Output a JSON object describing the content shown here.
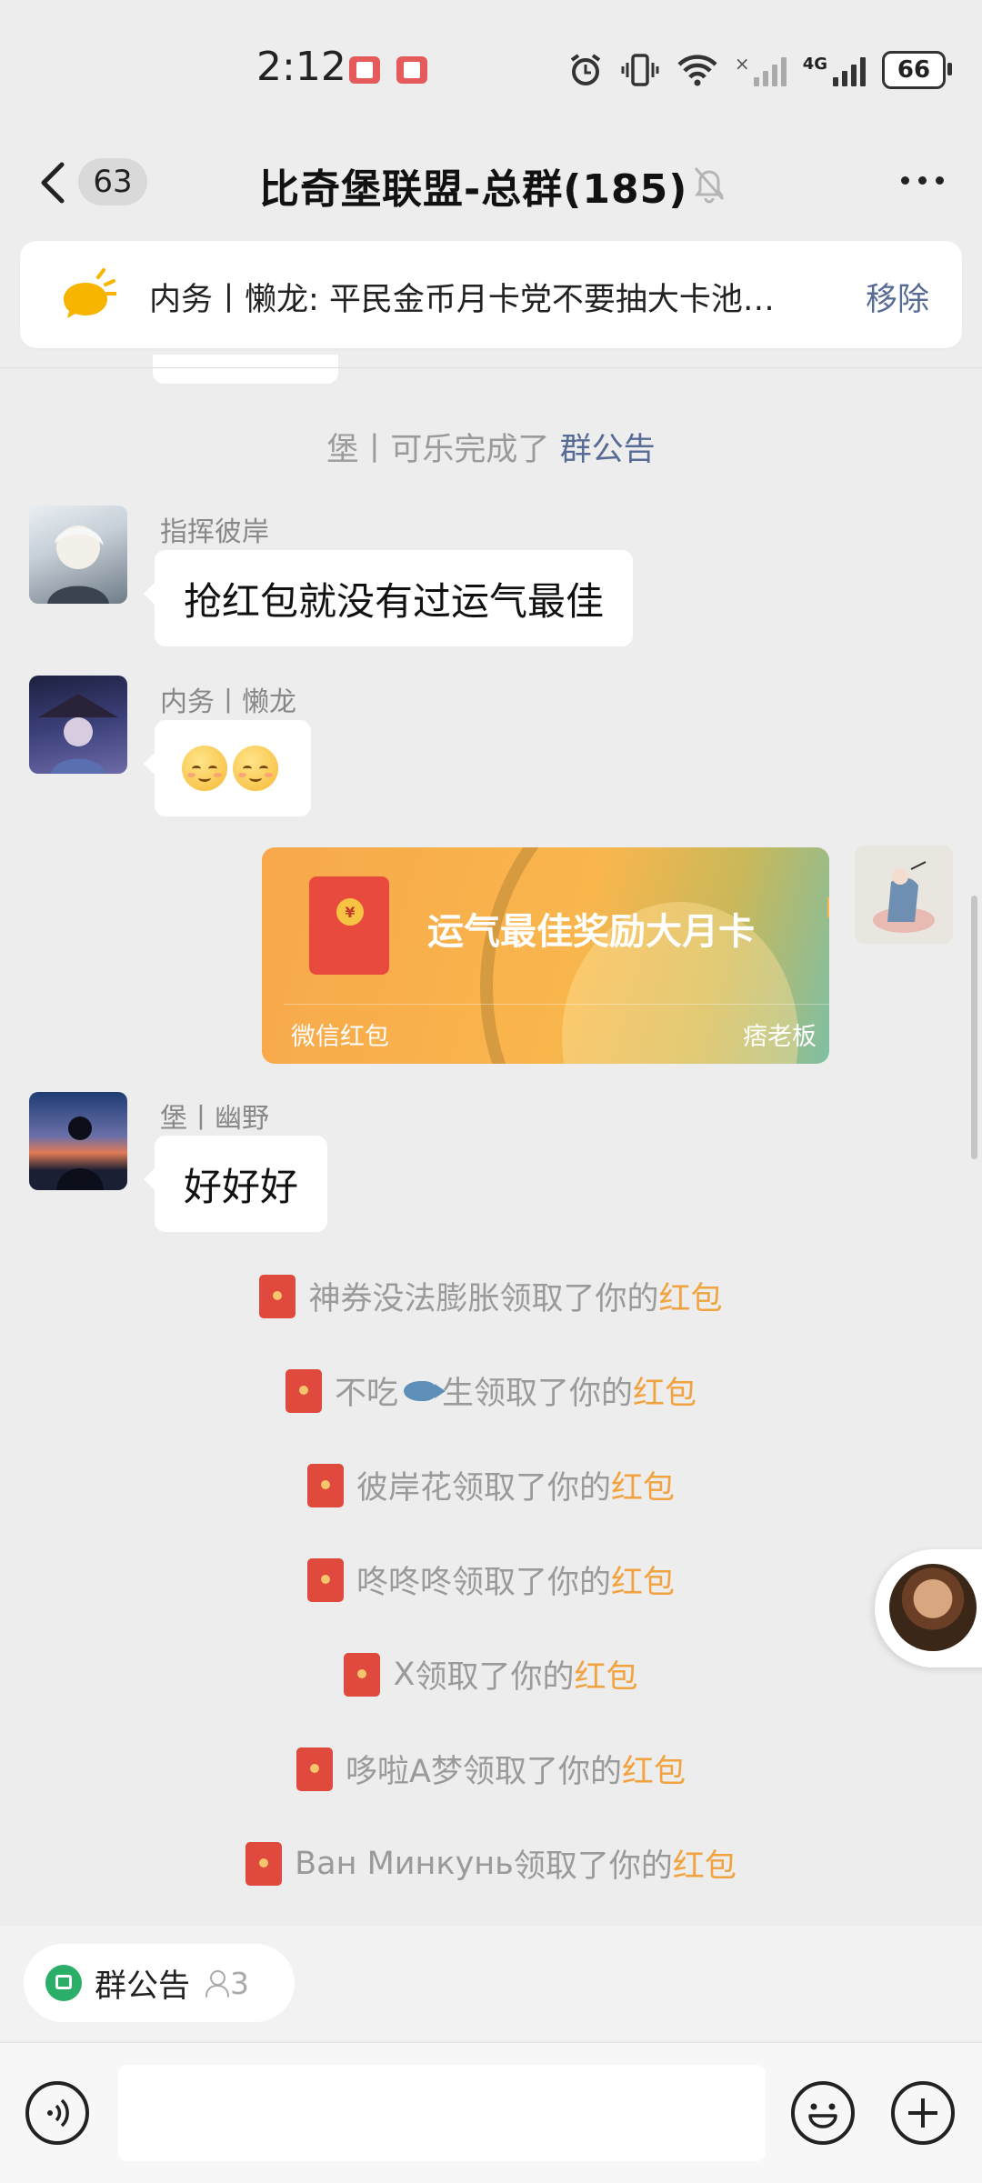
{
  "status_bar": {
    "time": "2:12",
    "battery": "66",
    "network": "4G",
    "icons": [
      "book-icon",
      "book-icon",
      "alarm-icon",
      "vibrate-icon",
      "wifi-icon",
      "signal-no-sim-icon",
      "signal-icon",
      "battery-icon"
    ]
  },
  "header": {
    "unread_count": "63",
    "title": "比奇堡联盟-总群(185)",
    "icons": [
      "back-arrow-icon",
      "mute-bell-icon",
      "more-dots-icon"
    ]
  },
  "pinned": {
    "text": "内务丨懒龙: 平民金币月卡党不要抽大卡池…",
    "remove_label": "移除"
  },
  "messages": {
    "notice_system": {
      "text": "堡丨可乐完成了 ",
      "link": "群公告"
    },
    "m1": {
      "sender": "指挥彼岸",
      "text": "抢红包就没有过运气最佳"
    },
    "m2": {
      "sender": "内务丨懒龙",
      "emoji": [
        "smiling-face-emoji",
        "smiling-face-emoji"
      ]
    },
    "red_packet": {
      "title": "运气最佳奖励大月卡",
      "footer_left": "微信红包",
      "footer_right": "痞老板",
      "coin": "¥"
    },
    "m3": {
      "sender": "堡丨幽野",
      "text": "好好好"
    }
  },
  "receipts": [
    {
      "name": "神券没法膨胀",
      "mid": "领取了你的",
      "link": "红包"
    },
    {
      "name_pre": "不吃",
      "name_post": " 生",
      "mid": "领取了你的",
      "link": "红包"
    },
    {
      "name": "彼岸花",
      "mid": "领取了你的",
      "link": "红包"
    },
    {
      "name": "咚咚咚",
      "mid": "领取了你的",
      "link": "红包"
    },
    {
      "name": "X",
      "mid": "领取了你的",
      "link": "红包"
    },
    {
      "name": "哆啦A梦",
      "mid": "领取了你的",
      "link": "红包"
    },
    {
      "name": "Ван Минкунь",
      "mid": "领取了你的",
      "link": "红包"
    }
  ],
  "bottom": {
    "announce_label": "群公告",
    "announce_count": "3",
    "input_value": ""
  }
}
